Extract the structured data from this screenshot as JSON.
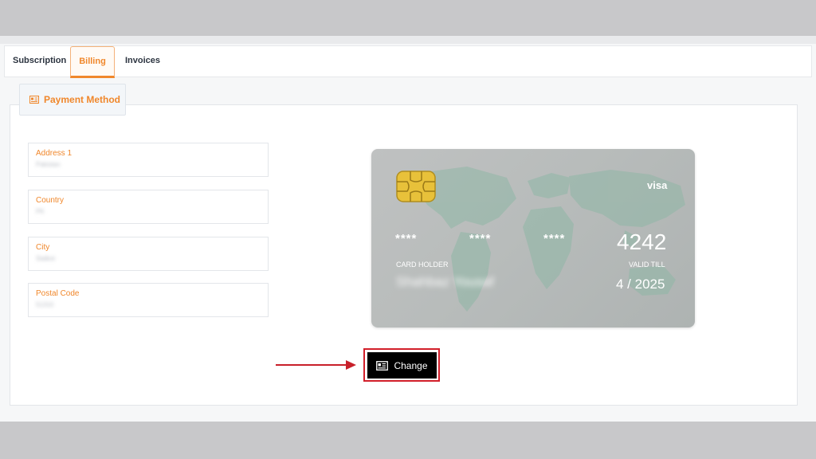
{
  "tabs": [
    {
      "label": "Subscription"
    },
    {
      "label": "Billing"
    },
    {
      "label": "Invoices"
    }
  ],
  "section": {
    "title": "Payment Method",
    "icon": "id-card-icon"
  },
  "fields": [
    {
      "label": "Address 1",
      "value": "Pakistan"
    },
    {
      "label": "Country",
      "value": "PK"
    },
    {
      "label": "City",
      "value": "Sialkot"
    },
    {
      "label": "Postal Code",
      "value": "51310"
    }
  ],
  "card": {
    "brand": "visa",
    "mask_groups": [
      "****",
      "****",
      "****"
    ],
    "last4": "4242",
    "holder_label": "CARD HOLDER",
    "holder_name": "Shahbaz Yousaf",
    "valid_label": "VALID TILL",
    "expiry": "4 / 2025"
  },
  "change_button": {
    "label": "Change",
    "icon": "id-card-icon"
  },
  "colors": {
    "accent": "#f0872b",
    "highlight": "#d21f2a",
    "button_bg": "#000000"
  }
}
